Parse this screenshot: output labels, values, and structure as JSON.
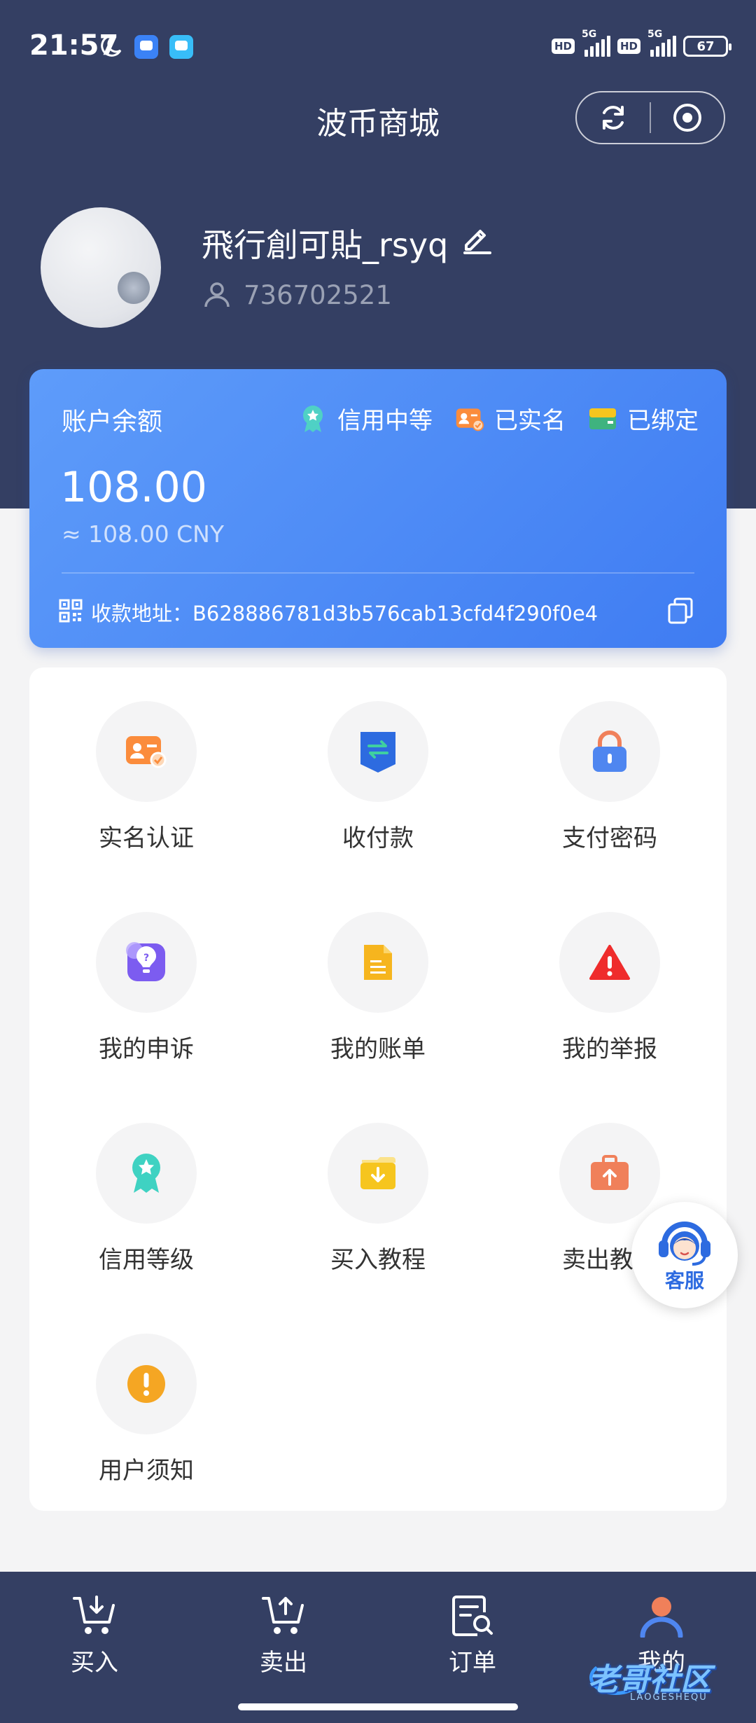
{
  "status_bar": {
    "time": "21:57",
    "network_1": "5G",
    "network_2": "5G",
    "hd_label": "HD",
    "battery": "67"
  },
  "header": {
    "title": "波币商城"
  },
  "profile": {
    "username": "飛行創可貼_rsyq",
    "user_id": "736702521"
  },
  "balance_card": {
    "label": "账户余额",
    "badges": [
      {
        "label": "信用中等",
        "icon": "ribbon-icon",
        "color": "#4fd1c5"
      },
      {
        "label": "已实名",
        "icon": "id-card-icon",
        "color": "#fb8c3c"
      },
      {
        "label": "已绑定",
        "icon": "wallet-icon",
        "color": "#3fb37f"
      }
    ],
    "amount": "108.00",
    "cny": "≈ 108.00 CNY",
    "address": "收款地址：B628886781d3b576cab13cfd4f290f0e4"
  },
  "menu": {
    "items": [
      {
        "label": "实名认证",
        "icon": "id-card-icon",
        "color": "#fb8c3c"
      },
      {
        "label": "收付款",
        "icon": "transfer-icon",
        "color": "#2d6be0"
      },
      {
        "label": "支付密码",
        "icon": "lock-icon",
        "color": "#4f86f0"
      },
      {
        "label": "我的申诉",
        "icon": "appeal-icon",
        "color": "#7c5cf0"
      },
      {
        "label": "我的账单",
        "icon": "bill-icon",
        "color": "#f6b51e"
      },
      {
        "label": "我的举报",
        "icon": "warning-icon",
        "color": "#ef2c2c"
      },
      {
        "label": "信用等级",
        "icon": "ribbon-icon",
        "color": "#3fd2c2"
      },
      {
        "label": "买入教程",
        "icon": "buy-tutorial-icon",
        "color": "#f6c51e"
      },
      {
        "label": "卖出教程",
        "icon": "sell-tutorial-icon",
        "color": "#f0805a"
      },
      {
        "label": "用户须知",
        "icon": "info-icon",
        "color": "#f5a623"
      }
    ]
  },
  "service": {
    "label": "客服"
  },
  "tabbar": {
    "items": [
      {
        "label": "买入",
        "icon": "cart-in-icon"
      },
      {
        "label": "卖出",
        "icon": "cart-out-icon"
      },
      {
        "label": "订单",
        "icon": "order-icon"
      },
      {
        "label": "我的",
        "icon": "profile-icon",
        "active": true
      }
    ]
  },
  "watermark": {
    "text": "老哥社区",
    "sub": "LAOGESHEQU"
  }
}
